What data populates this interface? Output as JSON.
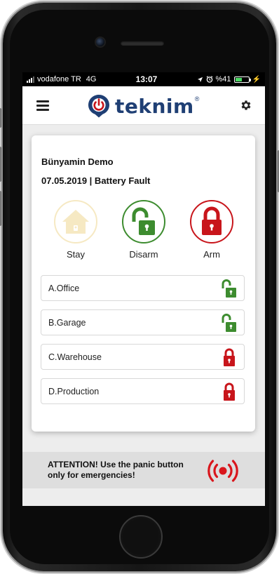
{
  "status_bar": {
    "carrier": "vodafone TR",
    "network": "4G",
    "time": "13:07",
    "battery_percent": "%41",
    "icons": [
      "signal-icon",
      "location-arrow-icon",
      "alarm-clock-icon",
      "battery-icon",
      "charging-bolt-icon"
    ]
  },
  "header": {
    "brand": "teknim",
    "brand_mark": "®",
    "brand_color": "#1f3f74",
    "left_icon": "menu-icon",
    "right_icon": "gear-icon"
  },
  "panel": {
    "user_name": "Bünyamin Demo",
    "status": "07.05.2019 | Battery Fault",
    "modes": [
      {
        "id": "stay",
        "label": "Stay",
        "icon": "home-icon",
        "color": "#f6e9c3"
      },
      {
        "id": "disarm",
        "label": "Disarm",
        "icon": "unlocked-padlock-icon",
        "color": "#3d8c2f"
      },
      {
        "id": "arm",
        "label": "Arm",
        "icon": "locked-padlock-icon",
        "color": "#c8151b"
      }
    ],
    "zones": [
      {
        "label": "A.Office",
        "state": "disarmed",
        "icon": "unlocked-padlock-icon"
      },
      {
        "label": "B.Garage",
        "state": "disarmed",
        "icon": "unlocked-padlock-icon"
      },
      {
        "label": "C.Warehouse",
        "state": "armed",
        "icon": "locked-padlock-icon"
      },
      {
        "label": "D.Production",
        "state": "armed",
        "icon": "locked-padlock-icon"
      }
    ]
  },
  "panic": {
    "message": "ATTENTION! Use the panic button only for emergencies!",
    "icon": "panic-alarm-icon",
    "color": "#d9161c"
  },
  "colors": {
    "disarmed_green": "#3d8c2f",
    "armed_red": "#c8151b",
    "stay_beige": "#f6e9c3"
  }
}
